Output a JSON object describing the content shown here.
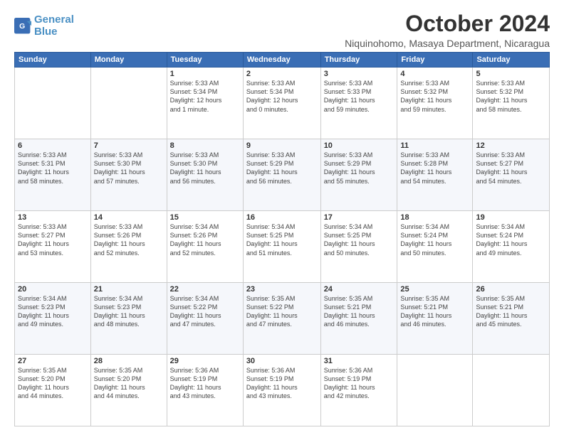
{
  "logo": {
    "line1": "General",
    "line2": "Blue"
  },
  "title": "October 2024",
  "location": "Niquinohomo, Masaya Department, Nicaragua",
  "weekdays": [
    "Sunday",
    "Monday",
    "Tuesday",
    "Wednesday",
    "Thursday",
    "Friday",
    "Saturday"
  ],
  "weeks": [
    [
      {
        "day": "",
        "info": ""
      },
      {
        "day": "",
        "info": ""
      },
      {
        "day": "1",
        "info": "Sunrise: 5:33 AM\nSunset: 5:34 PM\nDaylight: 12 hours\nand 1 minute."
      },
      {
        "day": "2",
        "info": "Sunrise: 5:33 AM\nSunset: 5:34 PM\nDaylight: 12 hours\nand 0 minutes."
      },
      {
        "day": "3",
        "info": "Sunrise: 5:33 AM\nSunset: 5:33 PM\nDaylight: 11 hours\nand 59 minutes."
      },
      {
        "day": "4",
        "info": "Sunrise: 5:33 AM\nSunset: 5:32 PM\nDaylight: 11 hours\nand 59 minutes."
      },
      {
        "day": "5",
        "info": "Sunrise: 5:33 AM\nSunset: 5:32 PM\nDaylight: 11 hours\nand 58 minutes."
      }
    ],
    [
      {
        "day": "6",
        "info": "Sunrise: 5:33 AM\nSunset: 5:31 PM\nDaylight: 11 hours\nand 58 minutes."
      },
      {
        "day": "7",
        "info": "Sunrise: 5:33 AM\nSunset: 5:30 PM\nDaylight: 11 hours\nand 57 minutes."
      },
      {
        "day": "8",
        "info": "Sunrise: 5:33 AM\nSunset: 5:30 PM\nDaylight: 11 hours\nand 56 minutes."
      },
      {
        "day": "9",
        "info": "Sunrise: 5:33 AM\nSunset: 5:29 PM\nDaylight: 11 hours\nand 56 minutes."
      },
      {
        "day": "10",
        "info": "Sunrise: 5:33 AM\nSunset: 5:29 PM\nDaylight: 11 hours\nand 55 minutes."
      },
      {
        "day": "11",
        "info": "Sunrise: 5:33 AM\nSunset: 5:28 PM\nDaylight: 11 hours\nand 54 minutes."
      },
      {
        "day": "12",
        "info": "Sunrise: 5:33 AM\nSunset: 5:27 PM\nDaylight: 11 hours\nand 54 minutes."
      }
    ],
    [
      {
        "day": "13",
        "info": "Sunrise: 5:33 AM\nSunset: 5:27 PM\nDaylight: 11 hours\nand 53 minutes."
      },
      {
        "day": "14",
        "info": "Sunrise: 5:33 AM\nSunset: 5:26 PM\nDaylight: 11 hours\nand 52 minutes."
      },
      {
        "day": "15",
        "info": "Sunrise: 5:34 AM\nSunset: 5:26 PM\nDaylight: 11 hours\nand 52 minutes."
      },
      {
        "day": "16",
        "info": "Sunrise: 5:34 AM\nSunset: 5:25 PM\nDaylight: 11 hours\nand 51 minutes."
      },
      {
        "day": "17",
        "info": "Sunrise: 5:34 AM\nSunset: 5:25 PM\nDaylight: 11 hours\nand 50 minutes."
      },
      {
        "day": "18",
        "info": "Sunrise: 5:34 AM\nSunset: 5:24 PM\nDaylight: 11 hours\nand 50 minutes."
      },
      {
        "day": "19",
        "info": "Sunrise: 5:34 AM\nSunset: 5:24 PM\nDaylight: 11 hours\nand 49 minutes."
      }
    ],
    [
      {
        "day": "20",
        "info": "Sunrise: 5:34 AM\nSunset: 5:23 PM\nDaylight: 11 hours\nand 49 minutes."
      },
      {
        "day": "21",
        "info": "Sunrise: 5:34 AM\nSunset: 5:23 PM\nDaylight: 11 hours\nand 48 minutes."
      },
      {
        "day": "22",
        "info": "Sunrise: 5:34 AM\nSunset: 5:22 PM\nDaylight: 11 hours\nand 47 minutes."
      },
      {
        "day": "23",
        "info": "Sunrise: 5:35 AM\nSunset: 5:22 PM\nDaylight: 11 hours\nand 47 minutes."
      },
      {
        "day": "24",
        "info": "Sunrise: 5:35 AM\nSunset: 5:21 PM\nDaylight: 11 hours\nand 46 minutes."
      },
      {
        "day": "25",
        "info": "Sunrise: 5:35 AM\nSunset: 5:21 PM\nDaylight: 11 hours\nand 46 minutes."
      },
      {
        "day": "26",
        "info": "Sunrise: 5:35 AM\nSunset: 5:21 PM\nDaylight: 11 hours\nand 45 minutes."
      }
    ],
    [
      {
        "day": "27",
        "info": "Sunrise: 5:35 AM\nSunset: 5:20 PM\nDaylight: 11 hours\nand 44 minutes."
      },
      {
        "day": "28",
        "info": "Sunrise: 5:35 AM\nSunset: 5:20 PM\nDaylight: 11 hours\nand 44 minutes."
      },
      {
        "day": "29",
        "info": "Sunrise: 5:36 AM\nSunset: 5:19 PM\nDaylight: 11 hours\nand 43 minutes."
      },
      {
        "day": "30",
        "info": "Sunrise: 5:36 AM\nSunset: 5:19 PM\nDaylight: 11 hours\nand 43 minutes."
      },
      {
        "day": "31",
        "info": "Sunrise: 5:36 AM\nSunset: 5:19 PM\nDaylight: 11 hours\nand 42 minutes."
      },
      {
        "day": "",
        "info": ""
      },
      {
        "day": "",
        "info": ""
      }
    ]
  ]
}
